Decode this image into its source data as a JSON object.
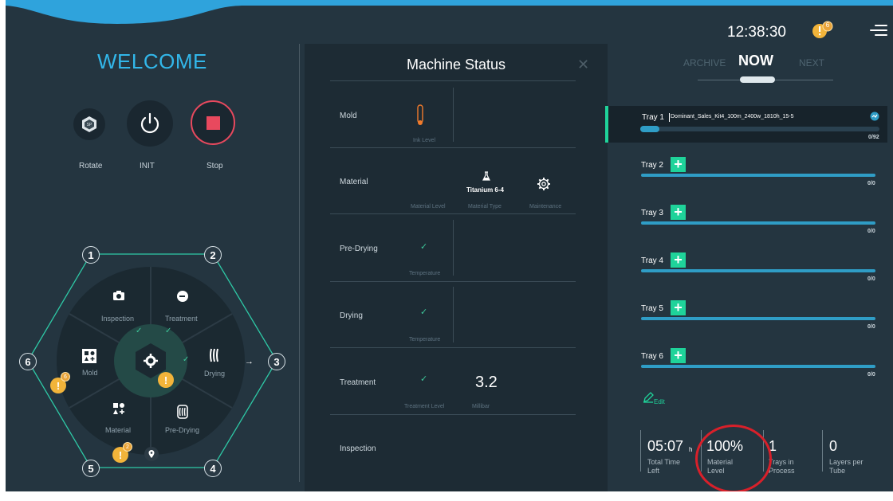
{
  "header": {
    "clock": "12:38:30",
    "alert_count": "6"
  },
  "left": {
    "welcome": "WELCOME",
    "buttons": {
      "rotate": "Rotate",
      "init": "INIT",
      "stop": "Stop"
    },
    "nodes": [
      "1",
      "2",
      "3",
      "4",
      "5",
      "6"
    ],
    "segments": {
      "inspection": "Inspection",
      "treatment": "Treatment",
      "drying": "Drying",
      "pre_drying": "Pre-Drying",
      "material": "Material",
      "mold": "Mold"
    },
    "badges": {
      "mold_count": "6",
      "material_count": "2"
    }
  },
  "machine_status": {
    "title": "Machine Status",
    "rows": {
      "mold": {
        "name": "Mold",
        "ink_level_label": "Ink Level"
      },
      "material": {
        "name": "Material",
        "material_level_label": "Material Level",
        "material_type": "Titanium 6-4",
        "material_type_label": "Material Type",
        "maintenance_label": "Maintenance"
      },
      "pre_drying": {
        "name": "Pre-Drying",
        "temperature_label": "Temperature"
      },
      "drying": {
        "name": "Drying",
        "temperature_label": "Temperature"
      },
      "treatment": {
        "name": "Treatment",
        "treatment_level_label": "Treatment Level",
        "pressure_value": "3.2",
        "pressure_unit": "Millibar"
      },
      "inspection": {
        "name": "Inspection"
      }
    }
  },
  "schedule": {
    "tabs": {
      "archive": "ARCHIVE",
      "now": "NOW",
      "next": "NEXT"
    },
    "tray1": {
      "name": "Tray 1",
      "job": "Dominant_Sales_Kit4_100m_2400w_1810h_15-5",
      "count": "0/92",
      "progress": 0.08
    },
    "trays": [
      {
        "name": "Tray 2",
        "count": "0/0"
      },
      {
        "name": "Tray 3",
        "count": "0/0"
      },
      {
        "name": "Tray 4",
        "count": "0/0"
      },
      {
        "name": "Tray 5",
        "count": "0/0"
      },
      {
        "name": "Tray 6",
        "count": "0/0"
      }
    ],
    "edit": "Edit"
  },
  "stats": {
    "time_left": {
      "value": "05:07",
      "unit": "h",
      "label1": "Total Time",
      "label2": "Left"
    },
    "material_level": {
      "value": "100%",
      "label1": "Material",
      "label2": "Level"
    },
    "trays_in_process": {
      "value": "1",
      "label1": "Trays in",
      "label2": "Process"
    },
    "layers_per_tube": {
      "value": "0",
      "label1": "Layers per",
      "label2": "Tube"
    }
  },
  "colors": {
    "accent_blue": "#32b7ea",
    "green": "#1fd39a",
    "stop_red": "#e8495e",
    "warning": "#f2b43a",
    "highlight_circle": "#d8202a"
  }
}
